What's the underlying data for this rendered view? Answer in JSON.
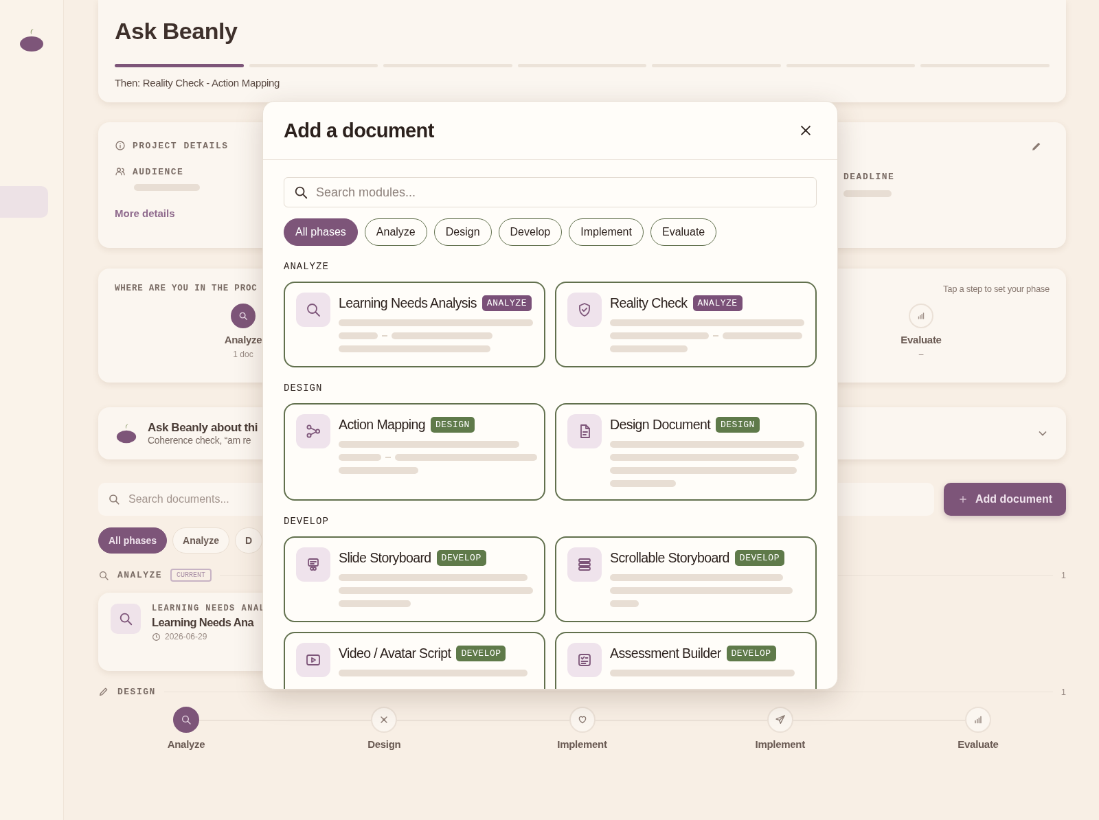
{
  "sidebar": {
    "items": [
      {
        "selected": true
      }
    ]
  },
  "header": {
    "title": "Ask Beanly",
    "progress": [
      {
        "done": true
      },
      {
        "done": false
      },
      {
        "done": false
      },
      {
        "done": false
      },
      {
        "done": false
      },
      {
        "done": false
      },
      {
        "done": false
      }
    ],
    "next_text": "Then: Reality Check - Action Mapping"
  },
  "project_details": {
    "label": "PROJECT DETAILS",
    "audience_label": "AUDIENCE",
    "deadline_label": "DEADLINE",
    "link": "More details"
  },
  "phase_picker": {
    "label": "WHERE ARE YOU IN THE PROC",
    "hint": "Tap a step to set your phase",
    "steps": [
      {
        "label": "Analyze",
        "count": "1 doc",
        "selected": true
      },
      {
        "label": "Evaluate",
        "count": "–",
        "selected": false
      }
    ]
  },
  "assistant": {
    "title": "Ask Beanly about thi",
    "subtitle": "Coherence check, “am re"
  },
  "documents": {
    "search_placeholder": "Search documents...",
    "add_button": "Add document",
    "filters": [
      {
        "label": "All phases",
        "selected": true
      },
      {
        "label": "Analyze",
        "selected": false
      },
      {
        "label": "D",
        "selected": false
      }
    ],
    "groups": [
      {
        "label": "ANALYZE",
        "badge": "CURRENT",
        "count": "1",
        "items": [
          {
            "eyebrow": "LEARNING NEEDS ANAL",
            "title": "Learning Needs Ana",
            "date": "2026-06-29"
          }
        ]
      },
      {
        "label": "DESIGN",
        "count": "1"
      }
    ]
  },
  "timeline": {
    "steps": [
      {
        "label": "Analyze",
        "selected": true
      },
      {
        "label": "Design",
        "selected": false
      },
      {
        "label": "Implement",
        "selected": false
      },
      {
        "label": "Implement",
        "selected": false
      },
      {
        "label": "Evaluate",
        "selected": false
      }
    ]
  },
  "modal": {
    "title": "Add a document",
    "search_placeholder": "Search modules...",
    "filters": [
      {
        "label": "All phases",
        "selected": true
      },
      {
        "label": "Analyze",
        "selected": false
      },
      {
        "label": "Design",
        "selected": false
      },
      {
        "label": "Develop",
        "selected": false
      },
      {
        "label": "Implement",
        "selected": false
      },
      {
        "label": "Evaluate",
        "selected": false
      }
    ],
    "sections": [
      {
        "label": "ANALYZE",
        "modules": [
          {
            "title": "Learning Needs Analysis",
            "tag": "ANALYZE",
            "color": "#7a5078"
          },
          {
            "title": "Reality Check",
            "tag": "ANALYZE",
            "color": "#7a5078"
          }
        ]
      },
      {
        "label": "DESIGN",
        "modules": [
          {
            "title": "Action Mapping",
            "tag": "DESIGN",
            "color": "#5f7a4a"
          },
          {
            "title": "Design Document",
            "tag": "DESIGN",
            "color": "#5f7a4a"
          }
        ]
      },
      {
        "label": "DEVELOP",
        "modules": [
          {
            "title": "Slide Storyboard",
            "tag": "DEVELOP",
            "color": "#5f7a4a"
          },
          {
            "title": "Scrollable Storyboard",
            "tag": "DEVELOP",
            "color": "#5f7a4a"
          },
          {
            "title": "Video / Avatar Script",
            "tag": "DEVELOP",
            "color": "#5f7a4a"
          },
          {
            "title": "Assessment Builder",
            "tag": "DEVELOP",
            "color": "#5f7a4a"
          }
        ]
      }
    ]
  }
}
